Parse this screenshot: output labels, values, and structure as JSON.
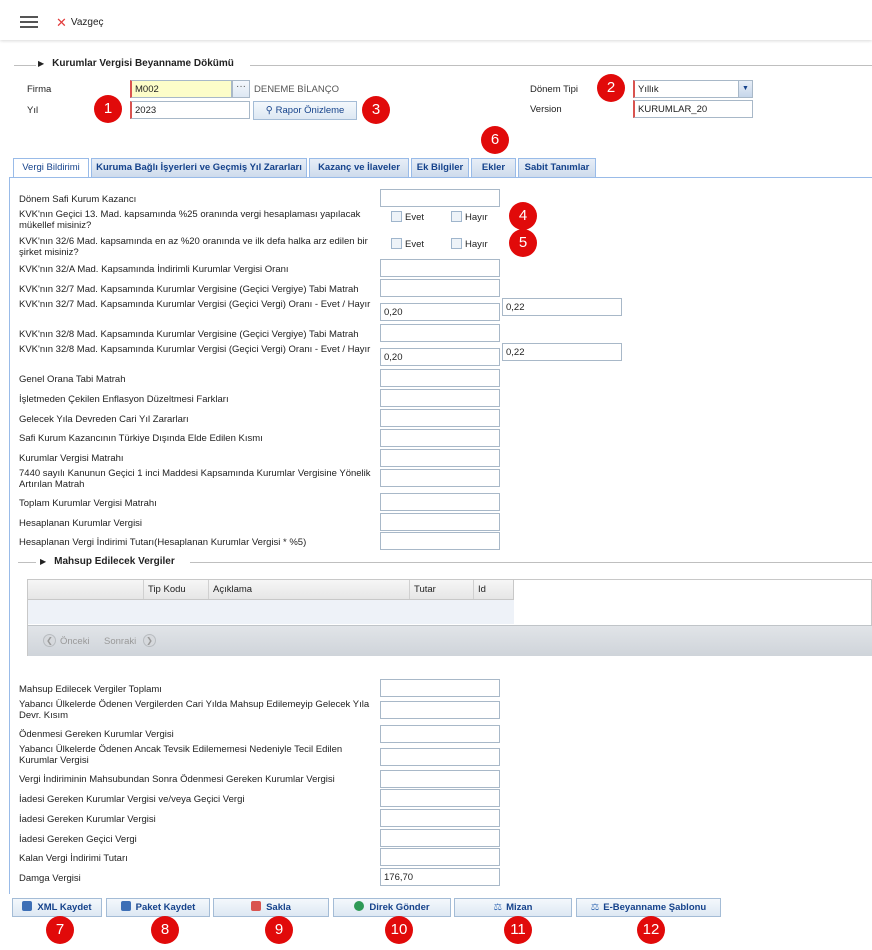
{
  "toolbar": {
    "cancel_label": "Vazgeç"
  },
  "header": {
    "section_title": "Kurumlar Vergisi Beyanname Dökümü",
    "firma_label": "Firma",
    "firma_code": "M002",
    "firma_name": "DENEME BİLANÇO",
    "yil_label": "Yıl",
    "yil_value": "2023",
    "preview_button": "Rapor Önizleme",
    "donem_tipi_label": "Dönem Tipi",
    "donem_tipi_value": "Yıllık",
    "version_label": "Version",
    "version_value": "KURUMLAR_20"
  },
  "tabs": [
    {
      "label": "Vergi Bildirimi",
      "active": true
    },
    {
      "label": "Kuruma Bağlı İşyerleri ve Geçmiş Yıl Zararları"
    },
    {
      "label": "Kazanç ve İlaveler"
    },
    {
      "label": "Ek Bilgiler"
    },
    {
      "label": "Ekler"
    },
    {
      "label": "Sabit Tanımlar"
    }
  ],
  "form": {
    "r1": "Dönem Safi Kurum Kazancı",
    "q1": "KVK'nın Geçici 13. Mad. kapsamında %25 oranında vergi hesaplaması yapılacak mükellef misiniz?",
    "q2": "KVK'nın 32/6 Mad. kapsamında en az %20 oranında ve ilk defa halka arz edilen bir şirket misiniz?",
    "evet": "Evet",
    "hayir": "Hayır",
    "r2": "KVK'nın 32/A Mad. Kapsamında İndirimli Kurumlar Vergisi Oranı",
    "r3": "KVK'nın 32/7 Mad. Kapsamında Kurumlar Vergisine (Geçici Vergiye) Tabi Matrah",
    "r4": "KVK'nın 32/7 Mad. Kapsamında Kurumlar Vergisi (Geçici Vergi) Oranı - Evet / Hayır",
    "r4_v1": "0,20",
    "r4_v2": "0,22",
    "r5": "KVK'nın 32/8 Mad. Kapsamında Kurumlar Vergisine (Geçici Vergiye) Tabi Matrah",
    "r6": "KVK'nın 32/8 Mad. Kapsamında Kurumlar Vergisi (Geçici Vergi) Oranı - Evet / Hayır",
    "r6_v1": "0,20",
    "r6_v2": "0,22",
    "r7": "Genel Orana Tabi Matrah",
    "r8": "İşletmeden Çekilen Enflasyon Düzeltmesi Farkları",
    "r9": "Gelecek Yıla Devreden Cari Yıl Zararları",
    "r10": "Safi Kurum Kazancının Türkiye Dışında Elde Edilen Kısmı",
    "r11": "Kurumlar Vergisi Matrahı",
    "r12": "7440 sayılı Kanunun Geçici 1 inci Maddesi Kapsamında Kurumlar Vergisine Yönelik Artırılan Matrah",
    "r13": "Toplam Kurumlar Vergisi Matrahı",
    "r14": "Hesaplanan Kurumlar Vergisi",
    "r15": "Hesaplanan Vergi İndirimi Tutarı(Hesaplanan Kurumlar Vergisi * %5)"
  },
  "mahsup": {
    "title": "Mahsup Edilecek Vergiler",
    "columns": [
      "Tip Kodu",
      "Açıklama",
      "Tutar",
      "Id"
    ],
    "prev": "Önceki",
    "next": "Sonraki"
  },
  "form2": {
    "s1": "Mahsup Edilecek Vergiler Toplamı",
    "s2": "Yabancı Ülkelerde Ödenen Vergilerden Cari Yılda Mahsup Edilemeyip Gelecek Yıla Devr. Kısım",
    "s3": "Ödenmesi Gereken Kurumlar Vergisi",
    "s4": "Yabancı Ülkelerde Ödenen Ancak Tevsik Edilememesi Nedeniyle Tecil Edilen Kurumlar Vergisi",
    "s5": "Vergi İndiriminin Mahsubundan Sonra Ödenmesi Gereken Kurumlar Vergisi",
    "s6": "İadesi Gereken Kurumlar Vergisi ve/veya Geçici Vergi",
    "s7": "İadesi Gereken Kurumlar Vergisi",
    "s8": "İadesi Gereken Geçici Vergi",
    "s9": "Kalan Vergi İndirimi Tutarı",
    "s10": "Damga Vergisi",
    "s10_value": "176,70"
  },
  "footer": {
    "xml": "XML Kaydet",
    "paket": "Paket Kaydet",
    "sakla": "Sakla",
    "direk": "Direk Gönder",
    "mizan": "Mizan",
    "ebeyan": "E-Beyanname Şablonu"
  },
  "badges": [
    "1",
    "2",
    "3",
    "4",
    "5",
    "6",
    "7",
    "8",
    "9",
    "10",
    "11",
    "12"
  ],
  "colors": {
    "badge": "#e10a0a",
    "accent": "#15428b",
    "required": "#d9534f"
  }
}
